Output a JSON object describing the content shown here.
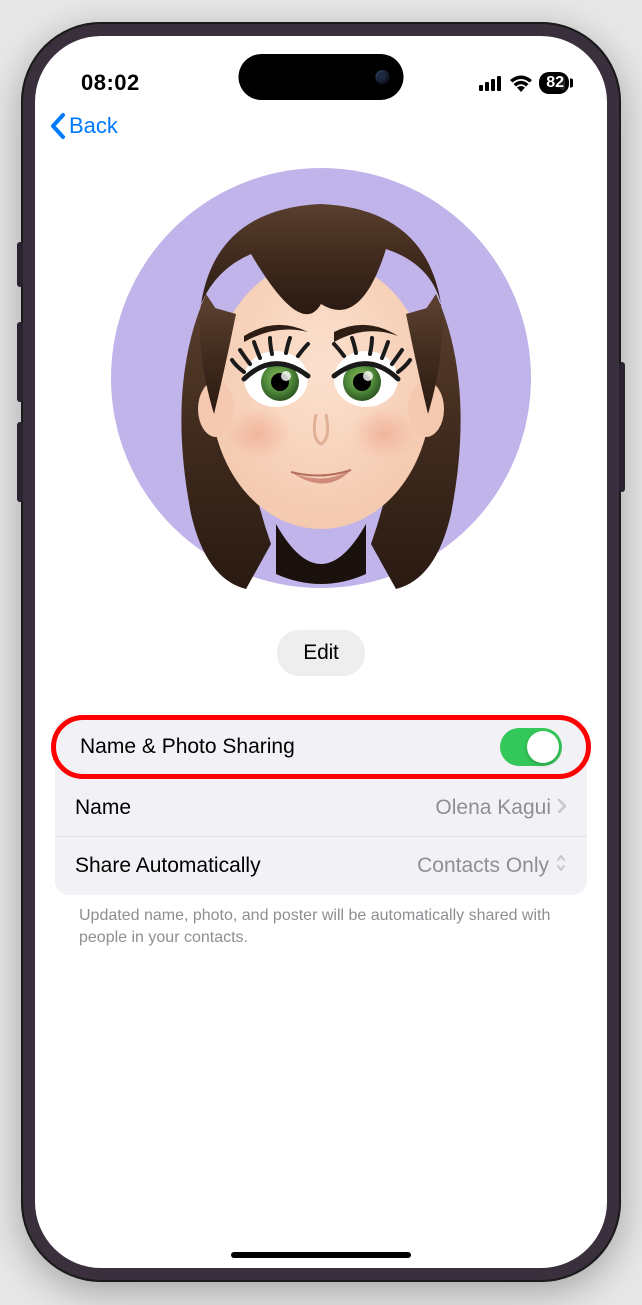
{
  "status_bar": {
    "time": "08:02",
    "battery": "82"
  },
  "nav": {
    "back": "Back"
  },
  "profile": {
    "avatar_bg": "#c0b4ea",
    "edit_label": "Edit"
  },
  "settings": {
    "rows": [
      {
        "label": "Name & Photo Sharing",
        "toggle": true
      },
      {
        "label": "Name",
        "value": "Olena Kagui"
      },
      {
        "label": "Share Automatically",
        "value": "Contacts Only"
      }
    ],
    "footer": "Updated name, photo, and poster will be automatically shared with people in your contacts."
  }
}
